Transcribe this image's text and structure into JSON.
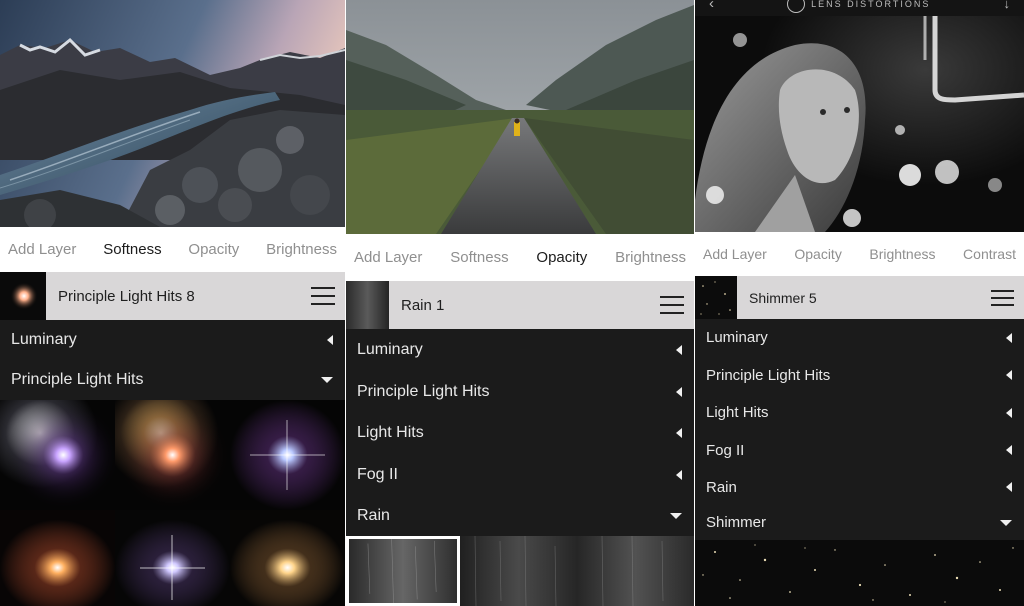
{
  "panels": [
    {
      "tabs": [
        "Add Layer",
        "Softness",
        "Opacity",
        "Brightness"
      ],
      "active_tab": "Softness",
      "layer": {
        "name": "Principle Light Hits 8"
      },
      "categories": [
        {
          "label": "Luminary",
          "state": "collapsed"
        },
        {
          "label": "Principle Light Hits",
          "state": "expanded"
        }
      ]
    },
    {
      "tabs": [
        "Add Layer",
        "Softness",
        "Opacity",
        "Brightness"
      ],
      "active_tab": "Opacity",
      "layer": {
        "name": "Rain 1"
      },
      "categories": [
        {
          "label": "Luminary",
          "state": "collapsed"
        },
        {
          "label": "Principle Light Hits",
          "state": "collapsed"
        },
        {
          "label": "Light Hits",
          "state": "collapsed"
        },
        {
          "label": "Fog II",
          "state": "collapsed"
        },
        {
          "label": "Rain",
          "state": "expanded"
        }
      ]
    },
    {
      "header": {
        "title": "LENS DISTORTIONS"
      },
      "tabs": [
        "Add Layer",
        "Opacity",
        "Brightness",
        "Contrast"
      ],
      "active_tab": "",
      "layer": {
        "name": "Shimmer 5"
      },
      "categories": [
        {
          "label": "Luminary",
          "state": "collapsed"
        },
        {
          "label": "Principle Light Hits",
          "state": "collapsed"
        },
        {
          "label": "Light Hits",
          "state": "collapsed"
        },
        {
          "label": "Fog II",
          "state": "collapsed"
        },
        {
          "label": "Rain",
          "state": "collapsed"
        },
        {
          "label": "Shimmer",
          "state": "expanded"
        }
      ]
    }
  ],
  "colors": {
    "panel_bg": "#1b1b1b",
    "tab_bar_bg": "#ffffff",
    "layer_row_bg": "#d9d7d8",
    "active_tab": "#1c1c1c",
    "inactive_tab": "#8f8f8f"
  }
}
